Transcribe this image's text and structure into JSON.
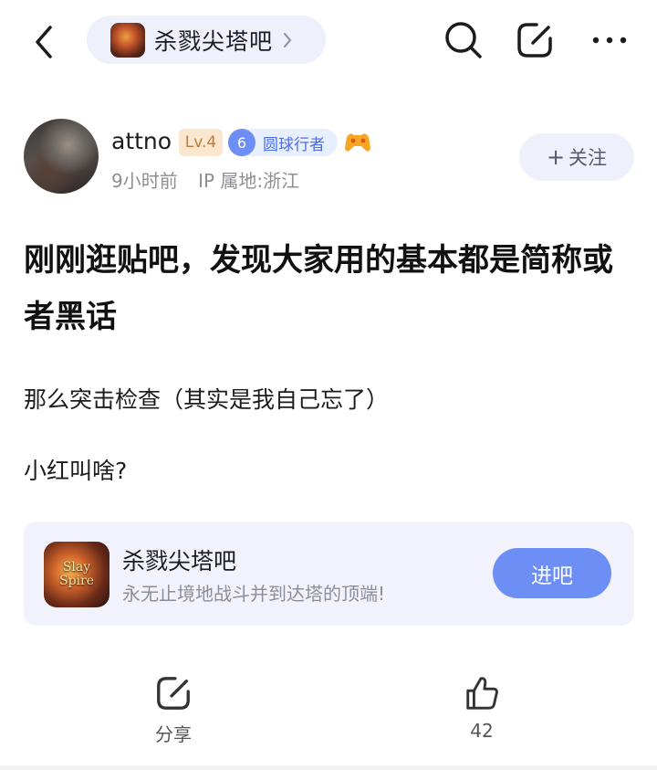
{
  "header": {
    "forum_name": "杀戮尖塔吧",
    "icons": [
      "back-icon",
      "chevron-right-icon",
      "search-icon",
      "edit-icon",
      "more-icon"
    ]
  },
  "author": {
    "username": "attno",
    "level_badge": "Lv.4",
    "rank_number": "6",
    "rank_title": "圆球行者",
    "time": "9小时前",
    "ip": "IP 属地:浙江",
    "follow_label": "关注",
    "follow_plus": "+"
  },
  "post": {
    "title": "刚刚逛贴吧，发现大家用的基本都是简称或者黑话",
    "paragraphs": [
      "那么突击检查（其实是我自己忘了）",
      "小红叫啥?"
    ]
  },
  "forum_card": {
    "name": "杀戮尖塔吧",
    "description": "永无止境地战斗并到达塔的顶端!",
    "logo_text_line1": "Slay",
    "logo_text_line2": "Spire",
    "enter_label": "进吧"
  },
  "actions": {
    "share_label": "分享",
    "like_count": "42"
  },
  "colors": {
    "accent": "#6d8ff5",
    "pill_bg": "#eef0fb",
    "card_bg": "#f1f2fb",
    "level_badge_bg": "#fbe6cf",
    "level_badge_text": "#c27a36"
  }
}
